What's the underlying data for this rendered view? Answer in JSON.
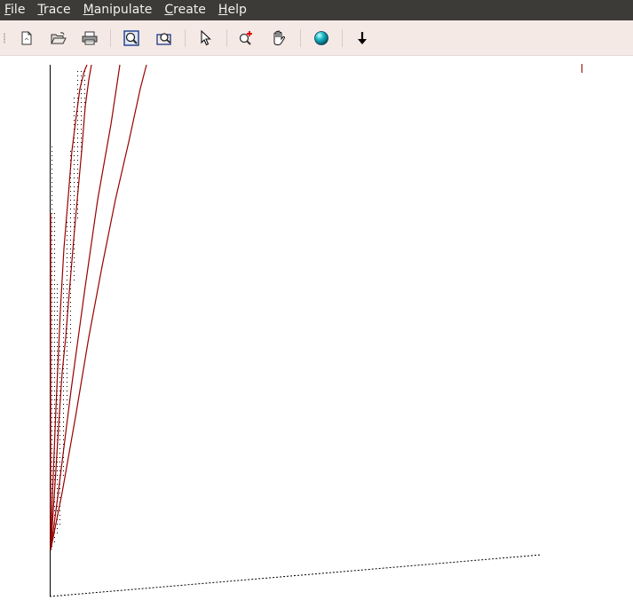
{
  "menubar": {
    "items": [
      {
        "mnemonic": "F",
        "rest": "ile"
      },
      {
        "mnemonic": "T",
        "rest": "race"
      },
      {
        "mnemonic": "M",
        "rest": "anipulate"
      },
      {
        "mnemonic": "C",
        "rest": "reate"
      },
      {
        "mnemonic": "H",
        "rest": "elp"
      }
    ]
  },
  "toolbar": {
    "icons": [
      "new-file-icon",
      "open-folder-icon",
      "printer-icon",
      "zoom-fit-icon",
      "zoom-region-icon",
      "pointer-icon",
      "zoom-in-icon",
      "pan-hand-icon",
      "globe-icon",
      "arrow-down-icon"
    ]
  },
  "colors": {
    "menubar_bg": "#3d3b37",
    "toolbar_bg": "#f5e9e6",
    "trace_line": "#990000",
    "axis": "#000000"
  }
}
